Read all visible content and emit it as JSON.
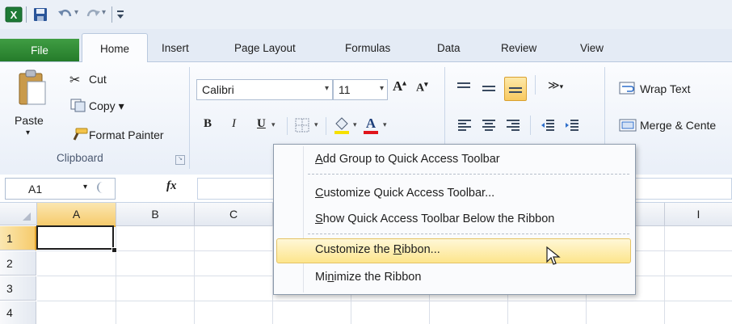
{
  "title_bar": {
    "quick_access": [
      "excel-app-icon",
      "save-icon",
      "undo-icon",
      "redo-icon",
      "customize-qat-icon"
    ]
  },
  "tabs": [
    {
      "label": "File"
    },
    {
      "label": "Home"
    },
    {
      "label": "Insert"
    },
    {
      "label": "Page Layout"
    },
    {
      "label": "Formulas"
    },
    {
      "label": "Data"
    },
    {
      "label": "Review"
    },
    {
      "label": "View"
    }
  ],
  "clipboard": {
    "paste_label": "Paste",
    "cut_label": "Cut",
    "copy_label": "Copy ▾",
    "format_painter_label": "Format Painter",
    "group_label": "Clipboard"
  },
  "font": {
    "name": "Calibri",
    "size": "11",
    "bold": "B",
    "italic": "I",
    "underline": "U"
  },
  "alignment": {
    "wrap_text_label": "Wrap Text",
    "merge_center_label": "Merge & Cente"
  },
  "formula_bar": {
    "name_box": "A1",
    "fx_label": "fx"
  },
  "grid": {
    "columns": [
      "A",
      "B",
      "C",
      "",
      "",
      "",
      "",
      "",
      "I"
    ],
    "rows": [
      "1",
      "2",
      "3",
      "4"
    ]
  },
  "context_menu": {
    "items": [
      {
        "pre": "",
        "u": "A",
        "post": "dd Group to Quick Access Toolbar"
      },
      {
        "pre": "",
        "u": "C",
        "post": "ustomize Quick Access Toolbar..."
      },
      {
        "pre": "",
        "u": "S",
        "post": "how Quick Access Toolbar Below the Ribbon"
      },
      {
        "pre": "Customize the ",
        "u": "R",
        "post": "ibbon..."
      },
      {
        "pre": "Mi",
        "u": "n",
        "post": "imize the Ribbon"
      }
    ]
  },
  "colors": {
    "file_tab": "#2e7d32",
    "hover_bg": "#fde58c",
    "hover_border": "#e5c365",
    "ribbon_bg": "#e9eff8"
  }
}
